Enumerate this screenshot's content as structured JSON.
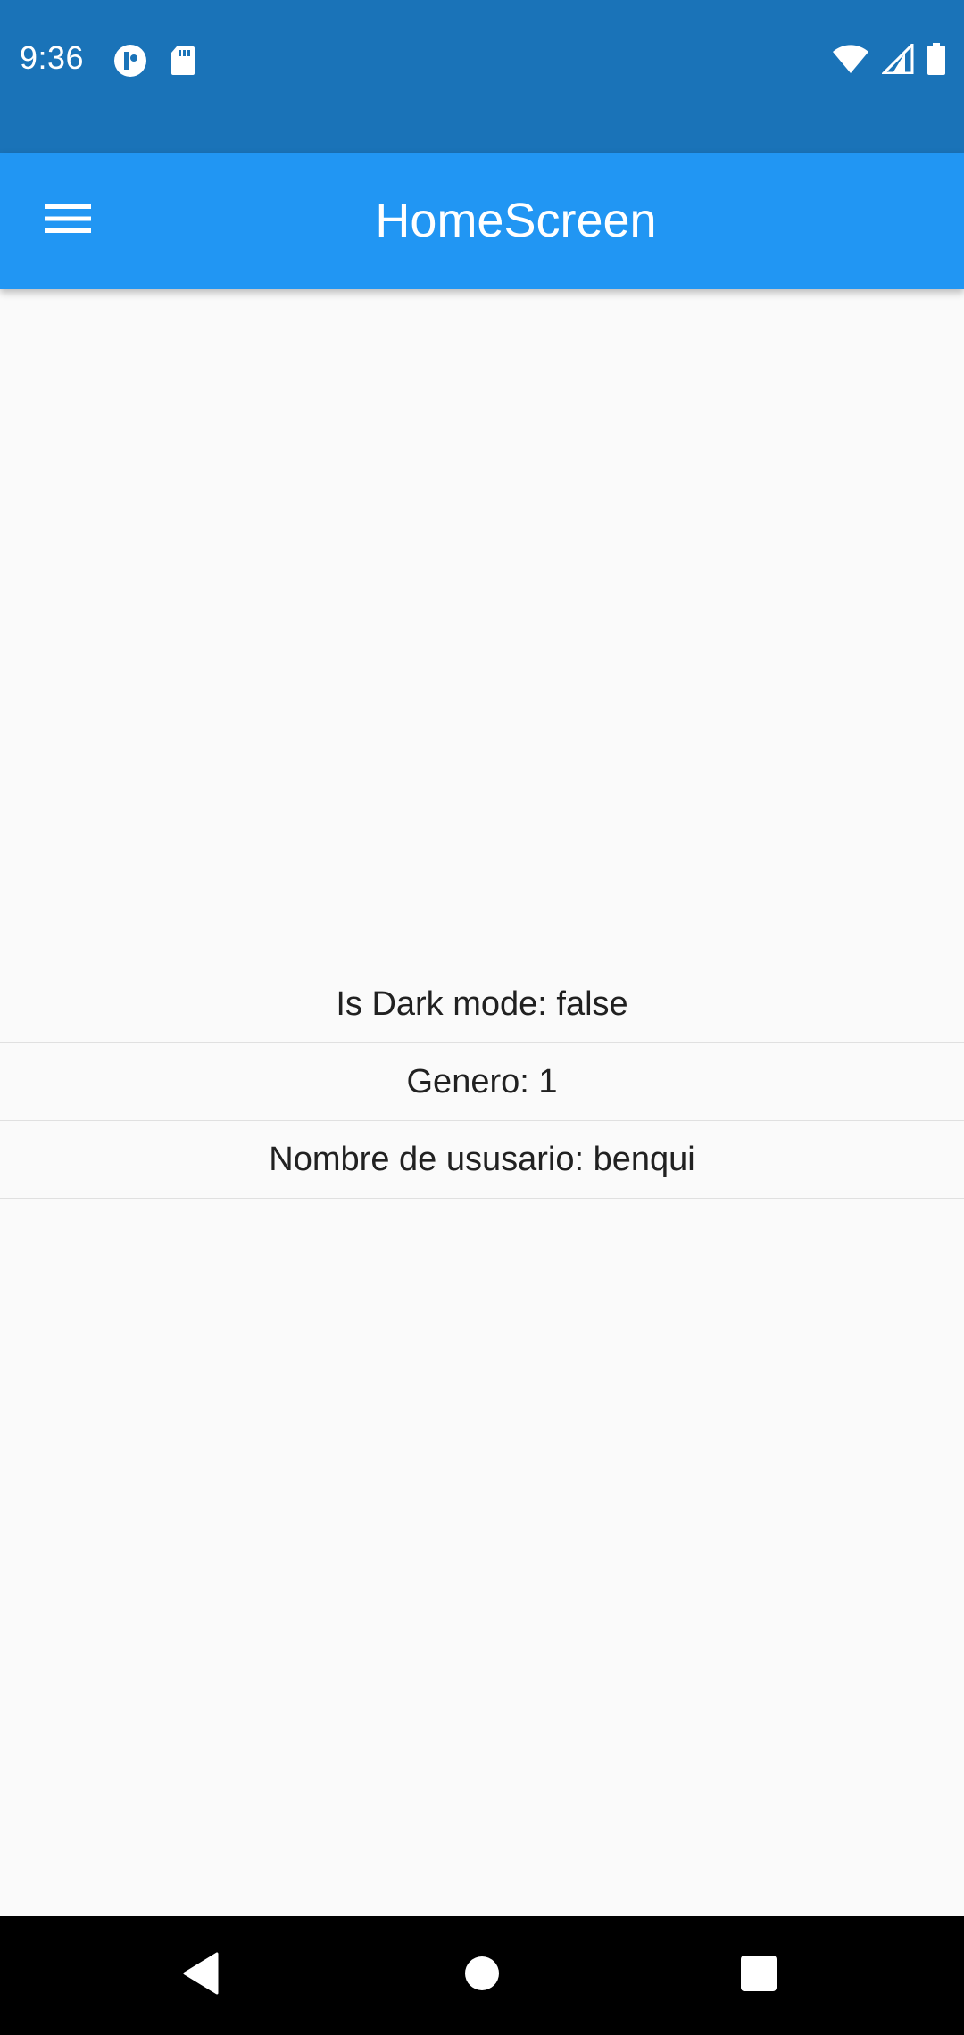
{
  "status_bar": {
    "time": "9:36",
    "left_icons": [
      "pocket-casts-icon",
      "sd-card-icon"
    ],
    "right_icons": [
      "wifi-icon",
      "cell-signal-icon",
      "battery-icon"
    ],
    "background_color": "#1a73b8"
  },
  "app_bar": {
    "title": "HomeScreen",
    "menu_icon": "hamburger-menu-icon",
    "background_color": "#2196f3"
  },
  "content": {
    "rows": [
      {
        "label": "Is Dark mode:",
        "value": "false",
        "text": "Is Dark mode:  false"
      },
      {
        "label": "Genero:",
        "value": "1",
        "text": "Genero:  1"
      },
      {
        "label": "Nombre de ususario:",
        "value": "benqui",
        "text": "Nombre de ususario:  benqui"
      }
    ]
  },
  "nav_bar": {
    "buttons": [
      "back-icon",
      "home-icon",
      "recents-icon"
    ]
  }
}
